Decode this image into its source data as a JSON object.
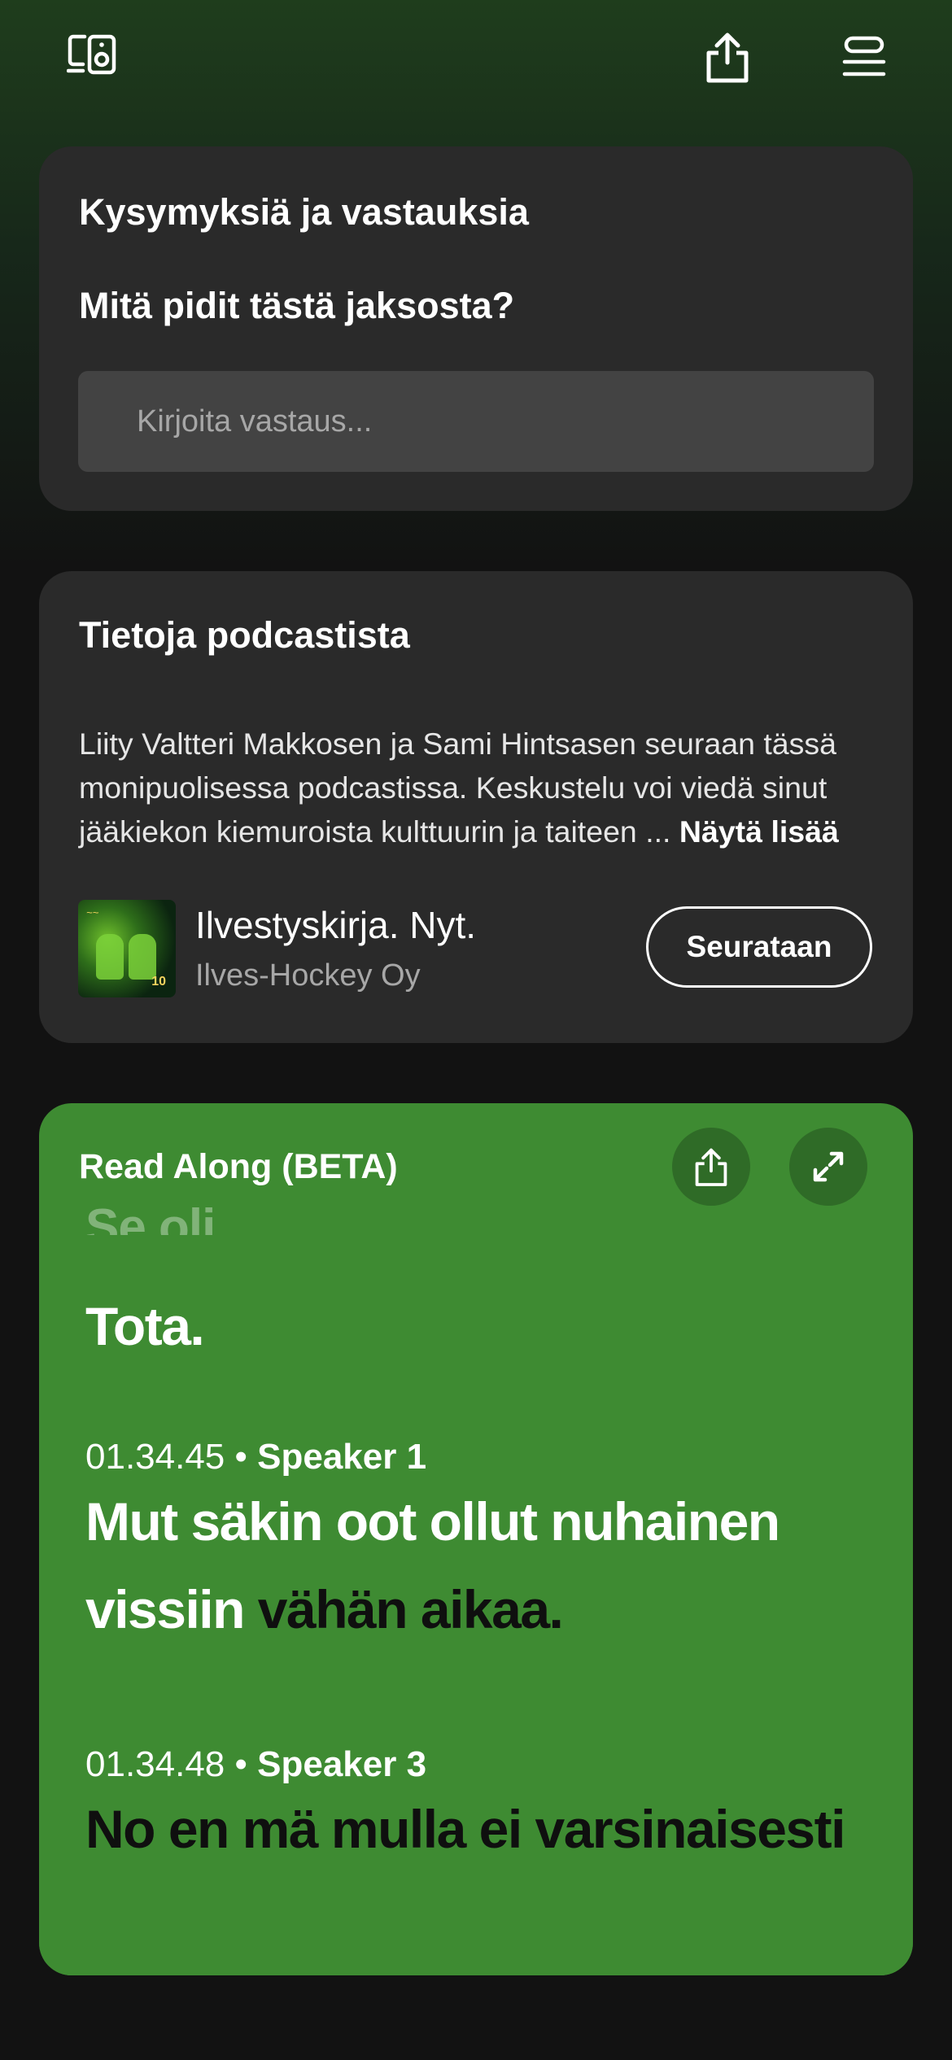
{
  "topbar": {
    "devices_icon": "connect-device-icon",
    "share_icon": "share-icon",
    "queue_icon": "queue-icon"
  },
  "qa": {
    "title": "Kysymyksiä ja vastauksia",
    "question": "Mitä pidit tästä jaksosta?",
    "placeholder": "Kirjoita vastaus..."
  },
  "about": {
    "title": "Tietoja podcastista",
    "description": "Liity Valtteri Makkosen ja Sami Hintsasen seuraan tässä monipuolisessa podcastissa. Keskustelu voi viedä sinut jääkiekon kiemuroista kulttuurin ja taiteen ...",
    "show_more": "Näytä lisää",
    "show_title": "Ilvestyskirja. Nyt.",
    "publisher": "Ilves-Hockey Oy",
    "follow_label": "Seurataan",
    "cover_number": "10"
  },
  "read_along": {
    "title": "Read Along (BETA)",
    "faded_text": "Se oli.",
    "line_0": "Tota.",
    "segments": [
      {
        "time": "01.34.45",
        "separator": " • ",
        "speaker": "Speaker 1",
        "text_spoken": "Mut säkin oot ollut nuhainen vissiin",
        "text_upcoming": " vähän aikaa."
      },
      {
        "time": "01.34.48",
        "separator": " • ",
        "speaker": "Speaker 3",
        "text_upcoming": "No en mä mulla ei varsinaisesti"
      }
    ]
  },
  "colors": {
    "background": "#121212",
    "card": "#2a2a2a",
    "read_along_card": "#3e8b32",
    "accent_dark_green": "#2f6b27"
  }
}
